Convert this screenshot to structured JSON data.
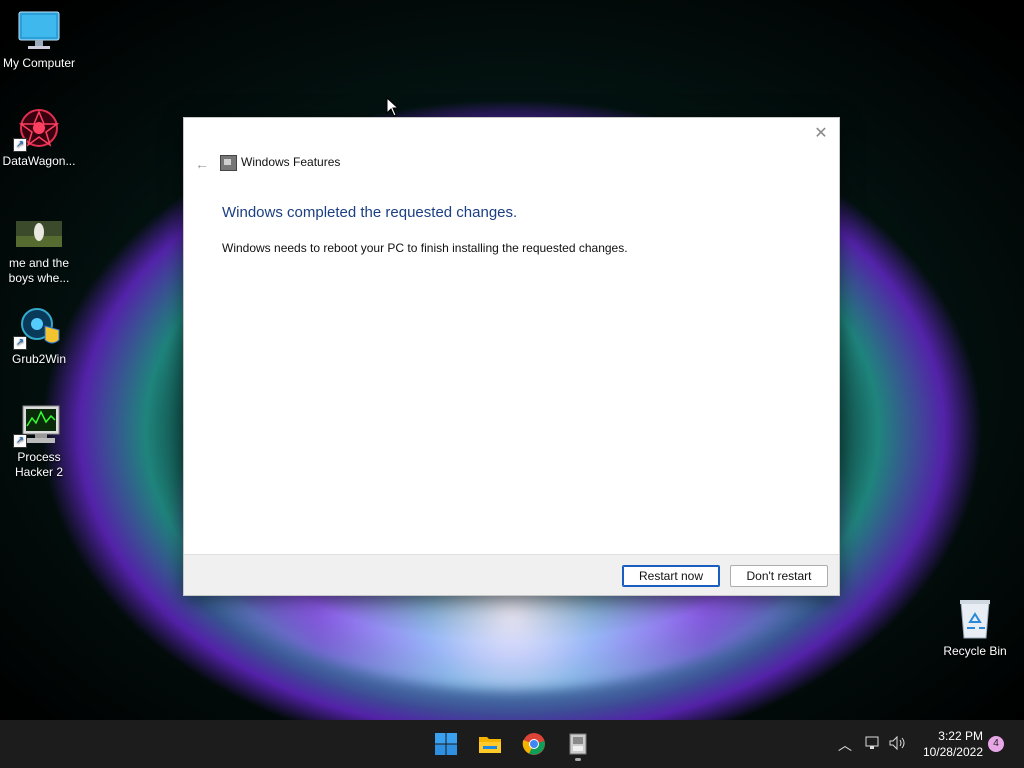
{
  "desktop": {
    "icons": [
      {
        "label": "My Computer"
      },
      {
        "label": "DataWagon..."
      },
      {
        "label": "me and the boys whe..."
      },
      {
        "label": "Grub2Win"
      },
      {
        "label": "Process Hacker 2"
      },
      {
        "label": "Recycle Bin"
      }
    ]
  },
  "dialog": {
    "title": "Windows Features",
    "heading": "Windows completed the requested changes.",
    "message": "Windows needs to reboot your PC to finish installing the requested changes.",
    "buttons": {
      "restart": "Restart now",
      "dont_restart": "Don't restart"
    }
  },
  "taskbar": {
    "apps": [
      "start-icon",
      "file-explorer-icon",
      "chrome-icon",
      "windows-features-icon"
    ],
    "clock": {
      "time": "3:22 PM",
      "date": "10/28/2022"
    },
    "notification_count": "4"
  },
  "colors": {
    "heading": "#1b3f82",
    "taskbar": "#1c1c1c",
    "accent": "#1a5ec1"
  }
}
